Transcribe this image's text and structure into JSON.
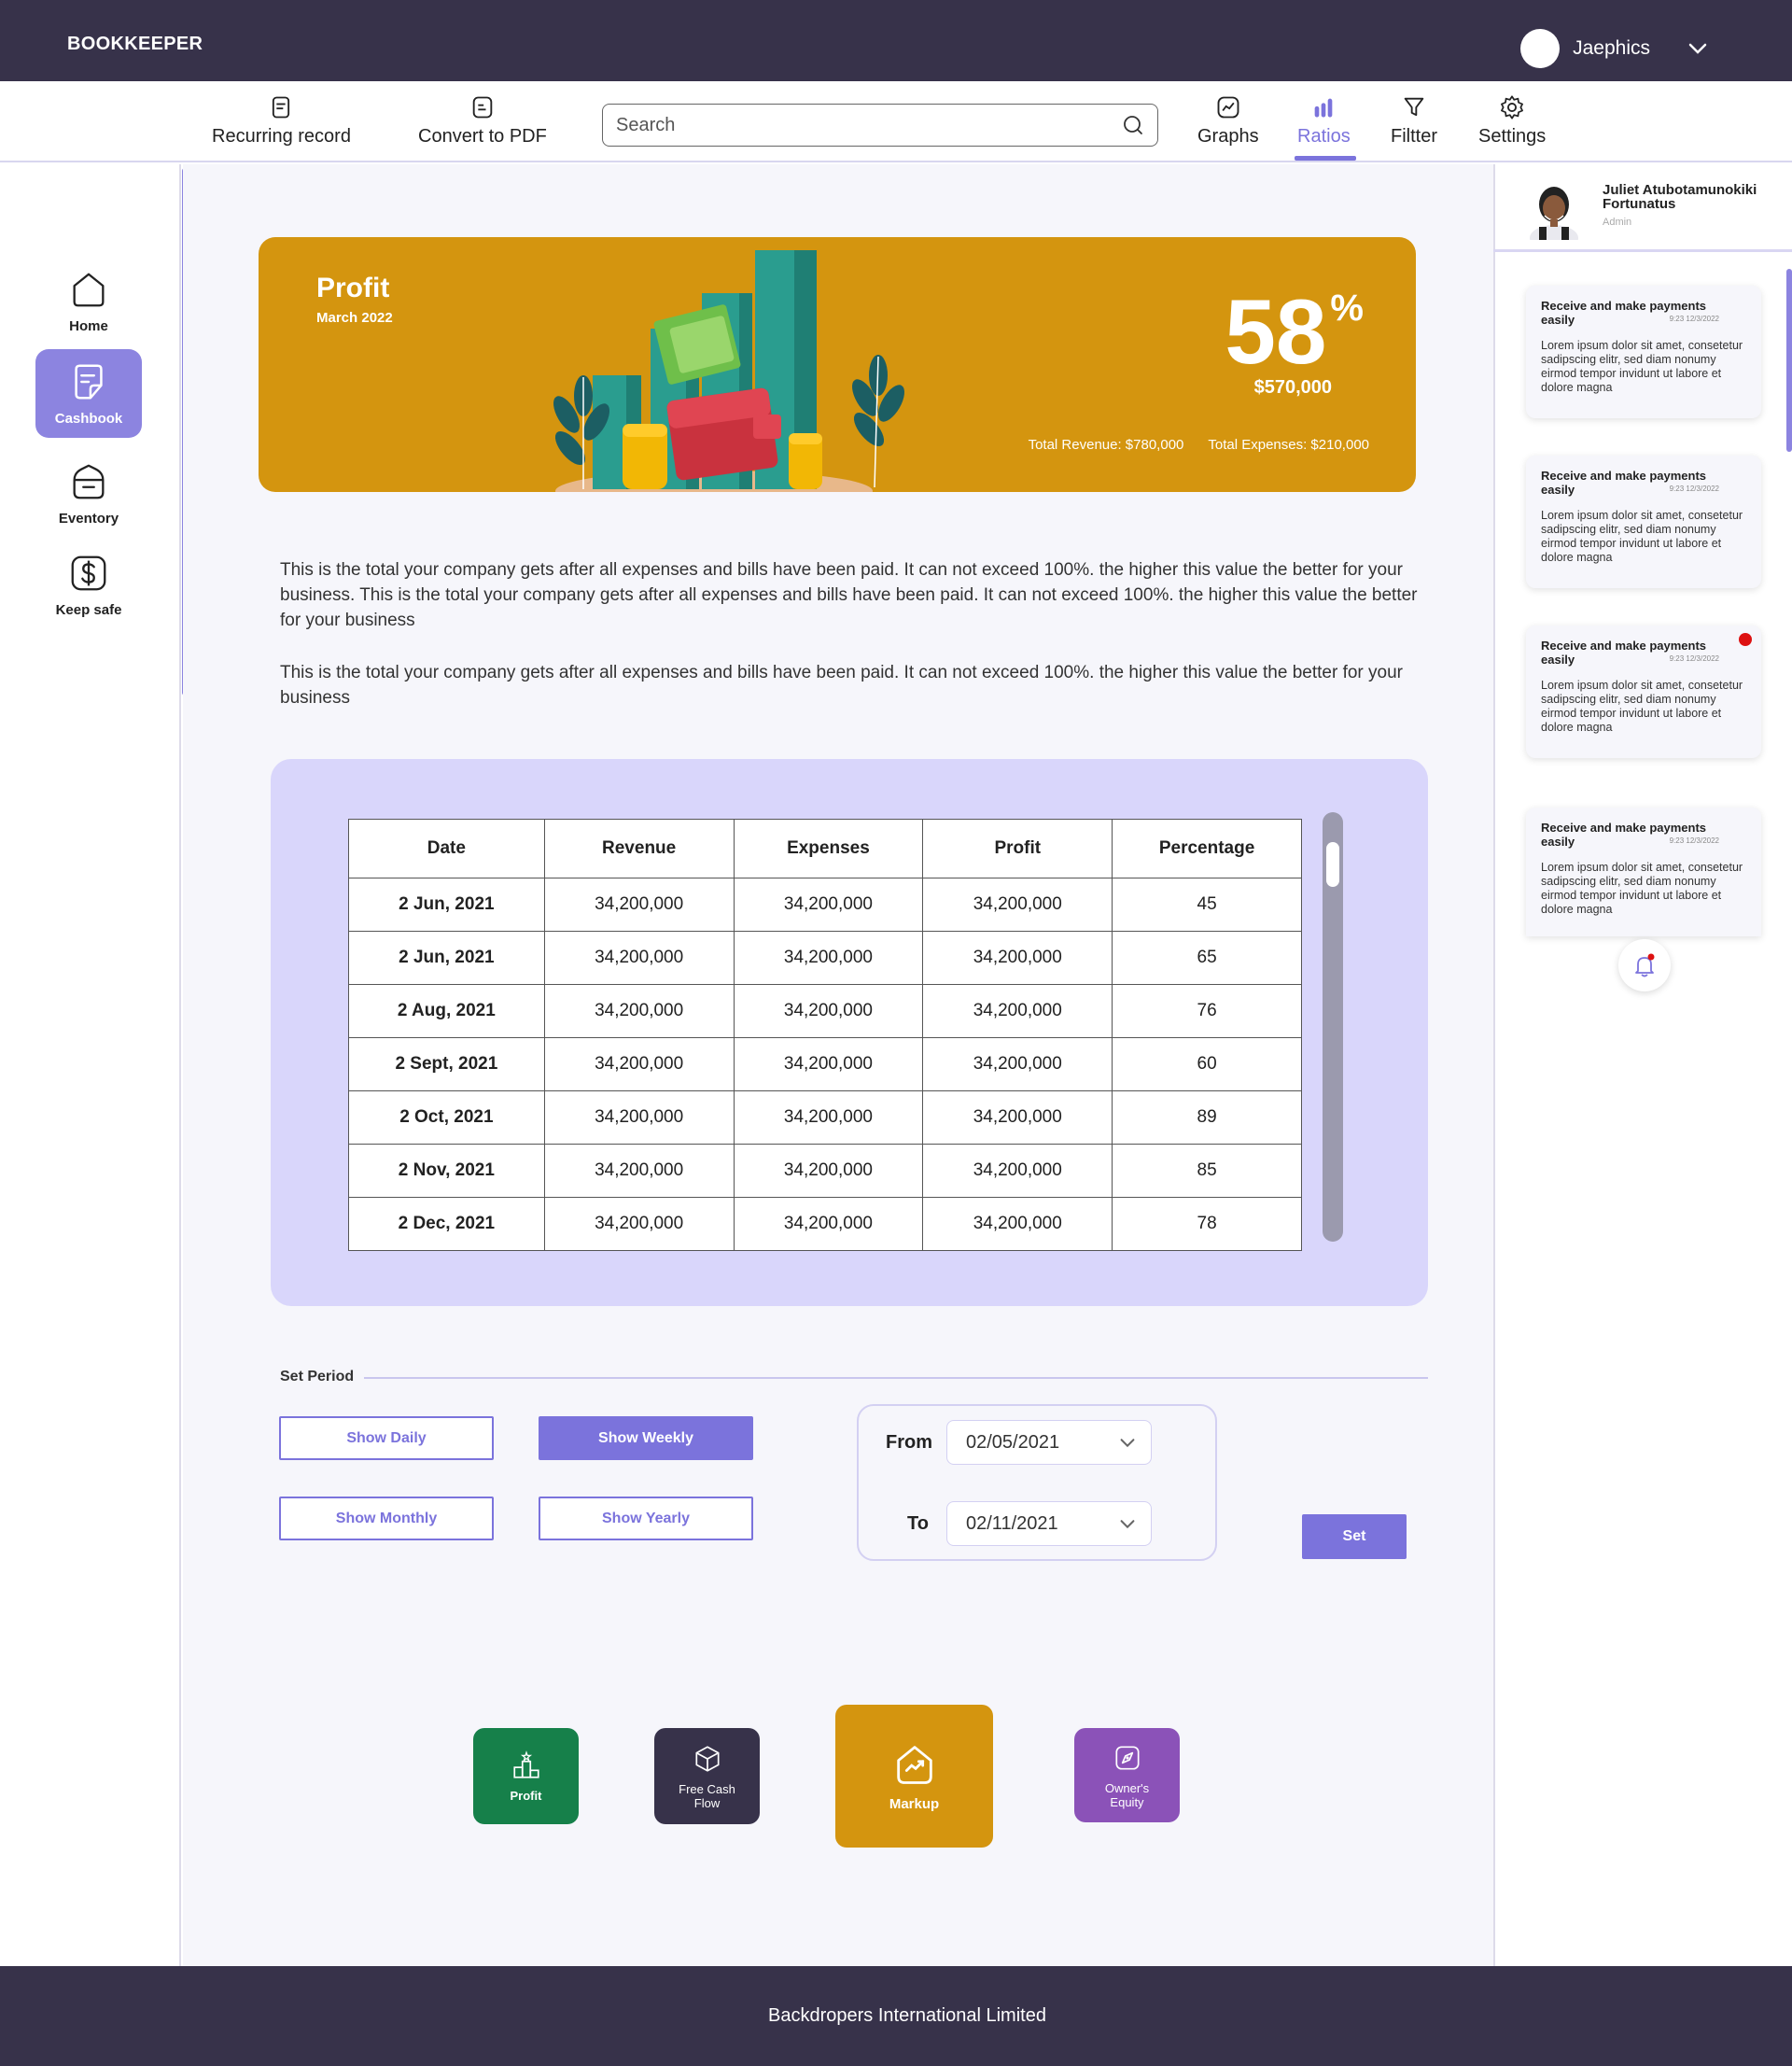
{
  "app": {
    "brand": "BOOKKEEPER"
  },
  "user": {
    "name": "Jaephics"
  },
  "toolbar": {
    "recurring": "Recurring record",
    "convert_pdf": "Convert to PDF",
    "search_placeholder": "Search",
    "graphs": "Graphs",
    "ratios": "Ratios",
    "filter": "Filtter",
    "settings": "Settings"
  },
  "sidebar": {
    "items": [
      {
        "label": "Home",
        "icon": "home-icon"
      },
      {
        "label": "Cashbook",
        "icon": "document-icon",
        "active": true
      },
      {
        "label": "Eventory",
        "icon": "inventory-box-icon"
      },
      {
        "label": "Keep safe",
        "icon": "dollar-icon"
      }
    ]
  },
  "banner": {
    "title": "Profit",
    "subtitle": "March 2022",
    "percent": "58",
    "percent_sign": "%",
    "amount": "$570,000",
    "total_revenue": "Total Revenue: $780,000",
    "total_expenses": "Total Expenses: $210,000"
  },
  "description": {
    "p1": "This is the total your company gets after all expenses and bills have been paid. It can not exceed 100%. the higher this value the better for your business. This is the total your company gets after all expenses and bills have been paid. It can not exceed 100%. the higher this value the better for your business",
    "p2": "This is the total your company gets after all expenses and bills have been paid. It can not exceed 100%. the higher this value the better for your business"
  },
  "table": {
    "headers": [
      "Date",
      "Revenue",
      "Expenses",
      "Profit",
      "Percentage"
    ],
    "rows": [
      [
        "2 Jun, 2021",
        "34,200,000",
        "34,200,000",
        "34,200,000",
        "45"
      ],
      [
        "2 Jun, 2021",
        "34,200,000",
        "34,200,000",
        "34,200,000",
        "65"
      ],
      [
        "2 Aug, 2021",
        "34,200,000",
        "34,200,000",
        "34,200,000",
        "76"
      ],
      [
        "2 Sept, 2021",
        "34,200,000",
        "34,200,000",
        "34,200,000",
        "60"
      ],
      [
        "2 Oct, 2021",
        "34,200,000",
        "34,200,000",
        "34,200,000",
        "89"
      ],
      [
        "2 Nov, 2021",
        "34,200,000",
        "34,200,000",
        "34,200,000",
        "85"
      ],
      [
        "2 Dec, 2021",
        "34,200,000",
        "34,200,000",
        "34,200,000",
        "78"
      ]
    ]
  },
  "period": {
    "label": "Set Period",
    "show_daily": "Show Daily",
    "show_weekly": "Show Weekly",
    "show_monthly": "Show Monthly",
    "show_yearly": "Show Yearly",
    "from_label": "From",
    "from_value": "02/05/2021",
    "to_label": "To",
    "to_value": "02/11/2021",
    "set": "Set"
  },
  "ratio_cards": {
    "profit": "Profit",
    "free_cash_flow": "Free Cash Flow",
    "markup": "Markup",
    "owners_equity": "Owner's Equity",
    "colors": {
      "profit": "#16804a",
      "free_cash_flow": "#37324a",
      "markup": "#d4950f",
      "owners_equity": "#8b52b8"
    }
  },
  "profile": {
    "name": "Juliet Atubotamunokiki Fortunatus",
    "role": "Admin"
  },
  "notifications": [
    {
      "title": "Receive and make payments easily",
      "time": "9:23  12/3/2022",
      "body": "Lorem ipsum dolor sit amet, consetetur sadipscing elitr, sed diam nonumy eirmod tempor invidunt ut labore et dolore magna",
      "unread": false
    },
    {
      "title": "Receive and make payments easily",
      "time": "9:23  12/3/2022",
      "body": "Lorem ipsum dolor sit amet, consetetur sadipscing elitr, sed diam nonumy eirmod tempor invidunt ut labore et dolore magna",
      "unread": false
    },
    {
      "title": "Receive and make payments easily",
      "time": "9:23  12/3/2022",
      "body": "Lorem ipsum dolor sit amet, consetetur sadipscing elitr, sed diam nonumy eirmod tempor invidunt ut labore et dolore magna",
      "unread": true
    },
    {
      "title": "Receive and make payments easily",
      "time": "9:23  12/3/2022",
      "body": "Lorem ipsum dolor sit amet, consetetur sadipscing elitr, sed diam nonumy eirmod tempor invidunt ut labore et dolore magna",
      "unread": false
    }
  ],
  "footer": {
    "text": "Backdropers International Limited"
  },
  "colors": {
    "dark": "#37324a",
    "accent": "#7b73dc",
    "banner": "#d4950f",
    "panel": "#d9d6fb"
  }
}
